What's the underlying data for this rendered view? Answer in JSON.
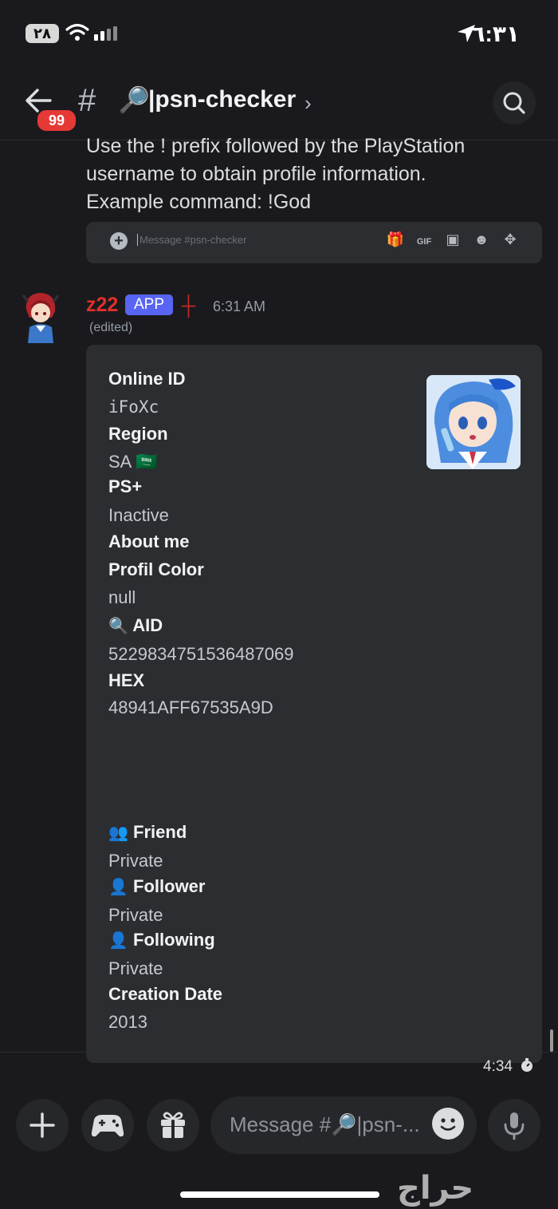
{
  "status_bar": {
    "battery": "٢٨",
    "time": "٦:٣١"
  },
  "header": {
    "unread_badge": "99",
    "hash": "#",
    "channel_emoji": "🔎",
    "channel_name": "|psn-checker",
    "chevron": "›"
  },
  "prior_message": {
    "lines": [
      "Use the ! prefix followed by the PlayStation",
      "username to obtain profile information.",
      "Example command: !God"
    ],
    "inline_placeholder": "Message #psn-checker",
    "inline_gif_label": "GIF"
  },
  "message": {
    "username": "z22",
    "app_badge": "APP",
    "time": "6:31 AM",
    "edited": "(edited)"
  },
  "embed": {
    "fields": [
      {
        "name": "Online ID",
        "value": "iFoXc",
        "mono": true
      },
      {
        "name": "Region",
        "value": "SA 🇸🇦"
      },
      {
        "name": "PS+",
        "value": "Inactive"
      },
      {
        "name": "About me",
        "value": ""
      },
      {
        "name": "Profil Color",
        "value": "null"
      },
      {
        "name": "AID",
        "value": "5229834751536487069",
        "icon": "🔍"
      },
      {
        "name": "HEX",
        "value": "48941AFF67535A9D"
      },
      {
        "name": "Friend",
        "value": "Private",
        "icon": "👥"
      },
      {
        "name": "Follower",
        "value": "Private",
        "icon": "👤"
      },
      {
        "name": "Following",
        "value": "Private",
        "icon": "👤"
      },
      {
        "name": "Creation Date",
        "value": "2013"
      }
    ]
  },
  "footer": {
    "time": "4:34"
  },
  "composer": {
    "placeholder": "Message #🔎|psn-..."
  },
  "watermark": "حراج",
  "colors": {
    "background": "#1a1a1e",
    "embed": "#2b2d31",
    "blurple": "#5865f2",
    "username_red": "#e0302a",
    "badge_red": "#e53935"
  }
}
